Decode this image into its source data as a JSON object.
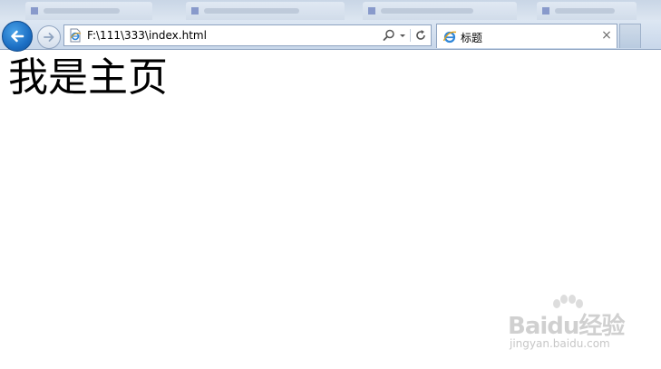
{
  "browser": {
    "address": "F:\\111\\333\\index.html",
    "active_tab": {
      "title": "标题",
      "close_symbol": "×"
    },
    "icons": {
      "back": "back-arrow-icon",
      "forward": "forward-arrow-icon",
      "page": "ie-page-icon",
      "search": "search-icon",
      "dropdown": "dropdown-icon",
      "refresh": "refresh-icon",
      "tab": "ie-logo-icon"
    },
    "colors": {
      "back_button": "#1c6fc4",
      "toolbar": "#c8d7ea"
    }
  },
  "page": {
    "heading": "我是主页"
  },
  "watermark": {
    "logo": "Baidu经验",
    "site": "jingyan.baidu.com"
  }
}
